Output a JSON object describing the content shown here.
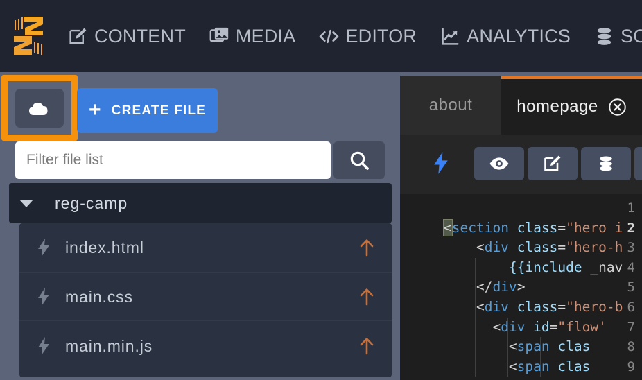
{
  "app": {
    "logo_name": "zesty-logo",
    "accent_orange": "#f5910a",
    "accent_blue": "#3b7ddd",
    "tab_active_border": "#e8761f"
  },
  "topnav": {
    "items": [
      {
        "label": "CONTENT",
        "icon": "edit-square-icon"
      },
      {
        "label": "MEDIA",
        "icon": "images-icon"
      },
      {
        "label": "EDITOR",
        "icon": "code-brackets-icon"
      },
      {
        "label": "ANALYTICS",
        "icon": "line-chart-icon"
      },
      {
        "label": "SO",
        "icon": "database-icon"
      }
    ]
  },
  "sidebar": {
    "upload_button": {
      "icon": "cloud-upload-icon",
      "highlighted": true
    },
    "create_button": {
      "label": "CREATE FILE",
      "icon": "plus-icon"
    },
    "filter": {
      "placeholder": "Filter file list",
      "value": ""
    },
    "search_button": {
      "icon": "search-icon"
    },
    "tree": {
      "folder": {
        "label": "reg-camp",
        "expanded": true,
        "caret": "caret-down-icon"
      },
      "files": [
        {
          "name": "index.html",
          "icon": "lightning-bolt-icon",
          "action": "arrow-up-icon"
        },
        {
          "name": "main.css",
          "icon": "lightning-bolt-icon",
          "action": "arrow-up-icon"
        },
        {
          "name": "main.min.js",
          "icon": "lightning-bolt-icon",
          "action": "arrow-up-icon"
        }
      ]
    }
  },
  "editor": {
    "tabs": [
      {
        "label": "about",
        "active": false,
        "closable": false
      },
      {
        "label": "homepage",
        "active": true,
        "closable": true,
        "close_icon": "close-circle-icon"
      }
    ],
    "toolbar": {
      "status_icon": "lightning-bolt-icon",
      "buttons": [
        {
          "icon": "eye-icon"
        },
        {
          "icon": "edit-square-icon"
        },
        {
          "icon": "database-icon"
        },
        {
          "icon": "database-icon"
        }
      ]
    },
    "code": {
      "line_numbers": [
        "1",
        "2",
        "3",
        "4",
        "5",
        "6",
        "7",
        "8",
        "9"
      ],
      "current_line": "2",
      "lines": [
        {
          "n": "1",
          "indent": 0,
          "tokens": []
        },
        {
          "n": "2",
          "indent": 0,
          "tokens": [
            {
              "t": "<",
              "c": "hl"
            },
            {
              "t": "section",
              "c": "tag"
            },
            {
              "t": " ",
              "c": "punc"
            },
            {
              "t": "class",
              "c": "attr"
            },
            {
              "t": "=",
              "c": "punc"
            },
            {
              "t": "\"hero i",
              "c": "str"
            }
          ]
        },
        {
          "n": "3",
          "indent": 0,
          "tokens": [
            {
              "t": "    <",
              "c": "punc"
            },
            {
              "t": "div",
              "c": "tag"
            },
            {
              "t": " ",
              "c": "punc"
            },
            {
              "t": "class",
              "c": "attr"
            },
            {
              "t": "=",
              "c": "punc"
            },
            {
              "t": "\"hero-h",
              "c": "str"
            }
          ]
        },
        {
          "n": "4",
          "indent": 1,
          "tokens": [
            {
              "t": "        {{",
              "c": "attr"
            },
            {
              "t": "include",
              "c": "attr"
            },
            {
              "t": " _nav",
              "c": "punc"
            }
          ]
        },
        {
          "n": "5",
          "indent": 1,
          "tokens": [
            {
              "t": "    </",
              "c": "punc"
            },
            {
              "t": "div",
              "c": "tag"
            },
            {
              "t": ">",
              "c": "punc"
            }
          ]
        },
        {
          "n": "6",
          "indent": 1,
          "tokens": [
            {
              "t": "    <",
              "c": "punc"
            },
            {
              "t": "div",
              "c": "tag"
            },
            {
              "t": " ",
              "c": "punc"
            },
            {
              "t": "class",
              "c": "attr"
            },
            {
              "t": "=",
              "c": "punc"
            },
            {
              "t": "\"hero-b",
              "c": "str"
            }
          ]
        },
        {
          "n": "7",
          "indent": 2,
          "tokens": [
            {
              "t": "      <",
              "c": "punc"
            },
            {
              "t": "div",
              "c": "tag"
            },
            {
              "t": " ",
              "c": "punc"
            },
            {
              "t": "id",
              "c": "attr"
            },
            {
              "t": "=",
              "c": "punc"
            },
            {
              "t": "\"flow'",
              "c": "str"
            }
          ]
        },
        {
          "n": "8",
          "indent": 3,
          "tokens": [
            {
              "t": "        <",
              "c": "punc"
            },
            {
              "t": "span",
              "c": "tag"
            },
            {
              "t": " ",
              "c": "punc"
            },
            {
              "t": "clas",
              "c": "attr"
            }
          ]
        },
        {
          "n": "9",
          "indent": 3,
          "tokens": [
            {
              "t": "        <",
              "c": "punc"
            },
            {
              "t": "span",
              "c": "tag"
            },
            {
              "t": " ",
              "c": "punc"
            },
            {
              "t": "clas",
              "c": "attr"
            }
          ]
        }
      ]
    }
  }
}
